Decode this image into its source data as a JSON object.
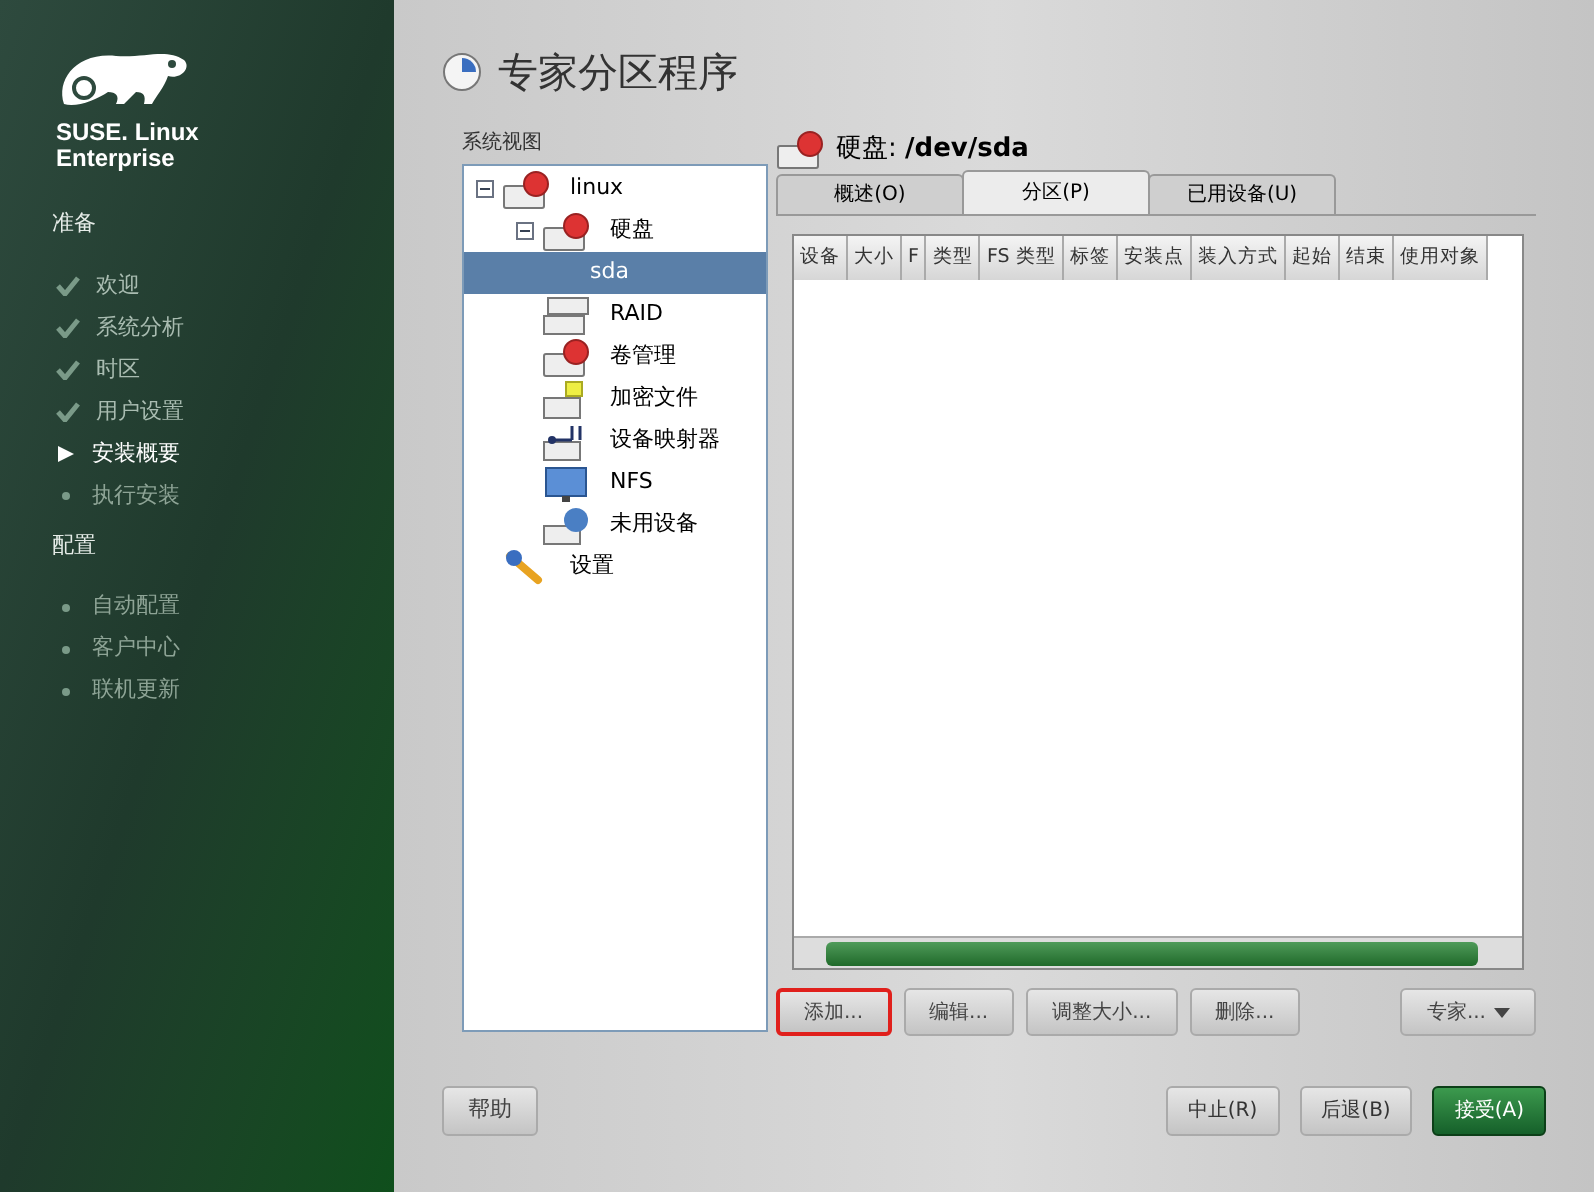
{
  "brand": {
    "line1": "SUSE. Linux",
    "line2": "Enterprise"
  },
  "sidebar": [
    {
      "heading": "准备",
      "items": [
        {
          "label": "欢迎",
          "kind": "done"
        },
        {
          "label": "系统分析",
          "kind": "done"
        },
        {
          "label": "时区",
          "kind": "done"
        },
        {
          "label": "用户设置",
          "kind": "done"
        },
        {
          "label": "安装概要",
          "kind": "current"
        },
        {
          "label": "执行安装",
          "kind": "pending"
        }
      ]
    },
    {
      "heading": "配置",
      "items": [
        {
          "label": "自动配置",
          "kind": "pending"
        },
        {
          "label": "客户中心",
          "kind": "pending"
        },
        {
          "label": "联机更新",
          "kind": "pending"
        }
      ]
    }
  ],
  "title": "专家分区程序",
  "tree": {
    "label": "系统视图",
    "items": [
      {
        "label": "linux",
        "kind": "disk",
        "selected": false,
        "expanded": true,
        "children": [
          {
            "label": "硬盘",
            "kind": "disk",
            "selected": false,
            "expanded": true,
            "children": [
              {
                "label": "sda",
                "selected": true
              }
            ]
          },
          {
            "label": "RAID",
            "kind": "raid",
            "selected": false
          },
          {
            "label": "卷管理",
            "kind": "volume",
            "selected": false
          },
          {
            "label": "加密文件",
            "kind": "crypt",
            "selected": false
          },
          {
            "label": "设备映射器",
            "kind": "devmapper",
            "selected": false
          },
          {
            "label": "NFS",
            "kind": "nfs",
            "selected": false
          },
          {
            "label": "未用设备",
            "kind": "unused",
            "selected": false
          }
        ]
      },
      {
        "label": "设置",
        "kind": "settings",
        "selected": false
      }
    ]
  },
  "device": {
    "heading": "硬盘: **/dev/sda**"
  },
  "tabs": [
    {
      "label": "概述(O)",
      "selected": false
    },
    {
      "label": "分区(P)",
      "selected": true
    },
    {
      "label": "已用设备(U)",
      "selected": false
    }
  ],
  "table": {
    "columns": [
      "设备",
      "大小",
      "F",
      "类型",
      "FS 类型",
      "标签",
      "安装点",
      "装入方式",
      "起始",
      "结束",
      "使用对象"
    ]
  },
  "actions": [
    {
      "label": "添加...",
      "highlighted": true,
      "dropdown": false
    },
    {
      "label": "编辑...",
      "highlighted": false,
      "dropdown": false
    },
    {
      "label": "调整大小...",
      "highlighted": false,
      "dropdown": false
    },
    {
      "label": "删除...",
      "highlighted": false,
      "dropdown": false
    },
    {
      "label": "专家...",
      "highlighted": false,
      "dropdown": true
    }
  ],
  "footer": {
    "help": "帮助",
    "buttons": [
      {
        "label": "中止(R)",
        "primary": false
      },
      {
        "label": "后退(B)",
        "primary": false
      },
      {
        "label": "接受(A)",
        "primary": true
      }
    ]
  }
}
